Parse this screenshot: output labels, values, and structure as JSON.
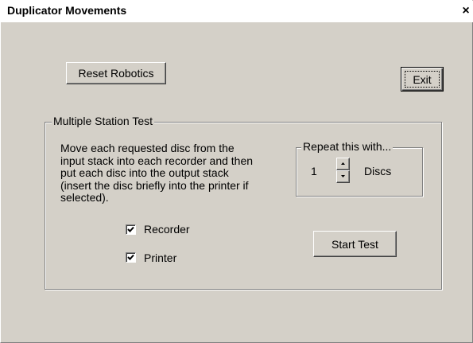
{
  "window": {
    "title": "Duplicator Movements",
    "close_glyph": "×"
  },
  "buttons": {
    "reset_robotics": "Reset Robotics",
    "exit": "Exit",
    "start_test": "Start Test"
  },
  "multiple_station_test": {
    "label": "Multiple Station Test",
    "description": "Move each requested disc from the\ninput stack into each recorder and then\nput each disc into the output stack\n(insert the disc briefly into the printer if\nselected).",
    "options": [
      {
        "label": "Recorder",
        "checked": true
      },
      {
        "label": "Printer",
        "checked": true
      }
    ]
  },
  "repeat": {
    "label": "Repeat this with...",
    "count": "1",
    "unit": "Discs"
  },
  "icons": {
    "close": "close-icon",
    "check": "checkmark-icon",
    "spin_up": "up-arrow-icon",
    "spin_down": "down-arrow-icon"
  }
}
